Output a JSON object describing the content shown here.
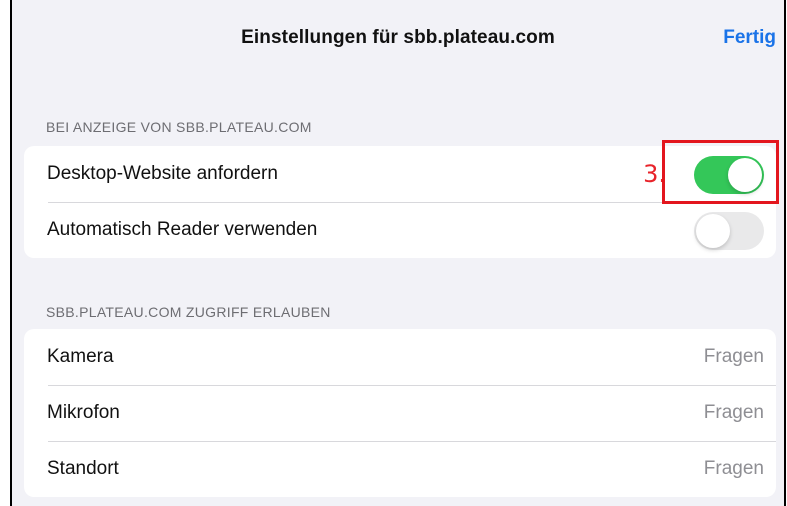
{
  "header": {
    "title": "Einstellungen für sbb.plateau.com",
    "done_label": "Fertig"
  },
  "section_display": {
    "title": "BEI ANZEIGE VON SBB.PLATEAU.COM",
    "rows": [
      {
        "label": "Desktop-Website anfordern",
        "toggle_on": true
      },
      {
        "label": "Automatisch Reader verwenden",
        "toggle_on": false
      }
    ]
  },
  "section_access": {
    "title": "SBB.PLATEAU.COM ZUGRIFF ERLAUBEN",
    "rows": [
      {
        "label": "Kamera",
        "value": "Fragen"
      },
      {
        "label": "Mikrofon",
        "value": "Fragen"
      },
      {
        "label": "Standort",
        "value": "Fragen"
      }
    ]
  },
  "annotation": {
    "step_label": "3.",
    "color": "#e3161e"
  },
  "colors": {
    "accent": "#1a73e8",
    "toggle_on": "#34c759",
    "toggle_off": "#e9e9ea",
    "background": "#f2f2f7"
  }
}
